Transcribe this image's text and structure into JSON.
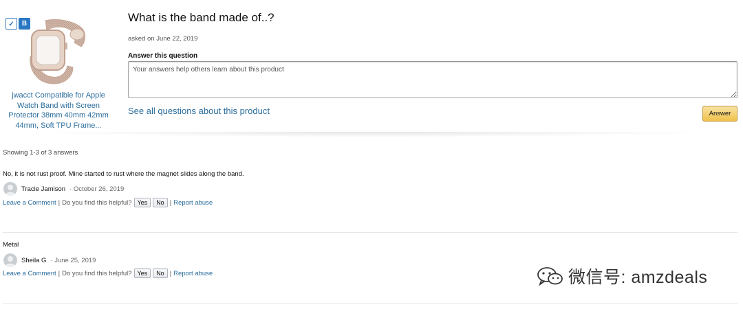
{
  "product": {
    "badges": [
      "✓",
      "B"
    ],
    "title": "jwacct Compatible for Apple Watch Band with Screen Protector 38mm 40mm 42mm 44mm, Soft TPU Frame..."
  },
  "question": {
    "title": "What is the band made of..?",
    "asked": "asked on June 22, 2019",
    "answer_label": "Answer this question",
    "answer_placeholder": "Your answers help others learn about this product",
    "see_all": "See all questions about this product",
    "answer_button": "Answer"
  },
  "answers_summary": "Showing 1-3 of 3 answers",
  "answers": [
    {
      "text": "No, it is not rust proof. Mine started to rust where the magnet slides along the band.",
      "author": "Tracie Jamison",
      "date": "· October 26, 2019",
      "leave_comment": "Leave a Comment",
      "helpful": "Do you find this helpful?",
      "yes": "Yes",
      "no": "No",
      "report": "Report abuse"
    },
    {
      "text": "Metal",
      "author": "Sheila G",
      "date": "· June 25, 2019",
      "leave_comment": "Leave a Comment",
      "helpful": "Do you find this helpful?",
      "yes": "Yes",
      "no": "No",
      "report": "Report abuse"
    }
  ],
  "watermark": {
    "text": "微信号: amzdeals",
    "icon": "wechat-icon"
  },
  "colors": {
    "link": "#2a6c9c",
    "answer_button": "#f0c14b"
  }
}
